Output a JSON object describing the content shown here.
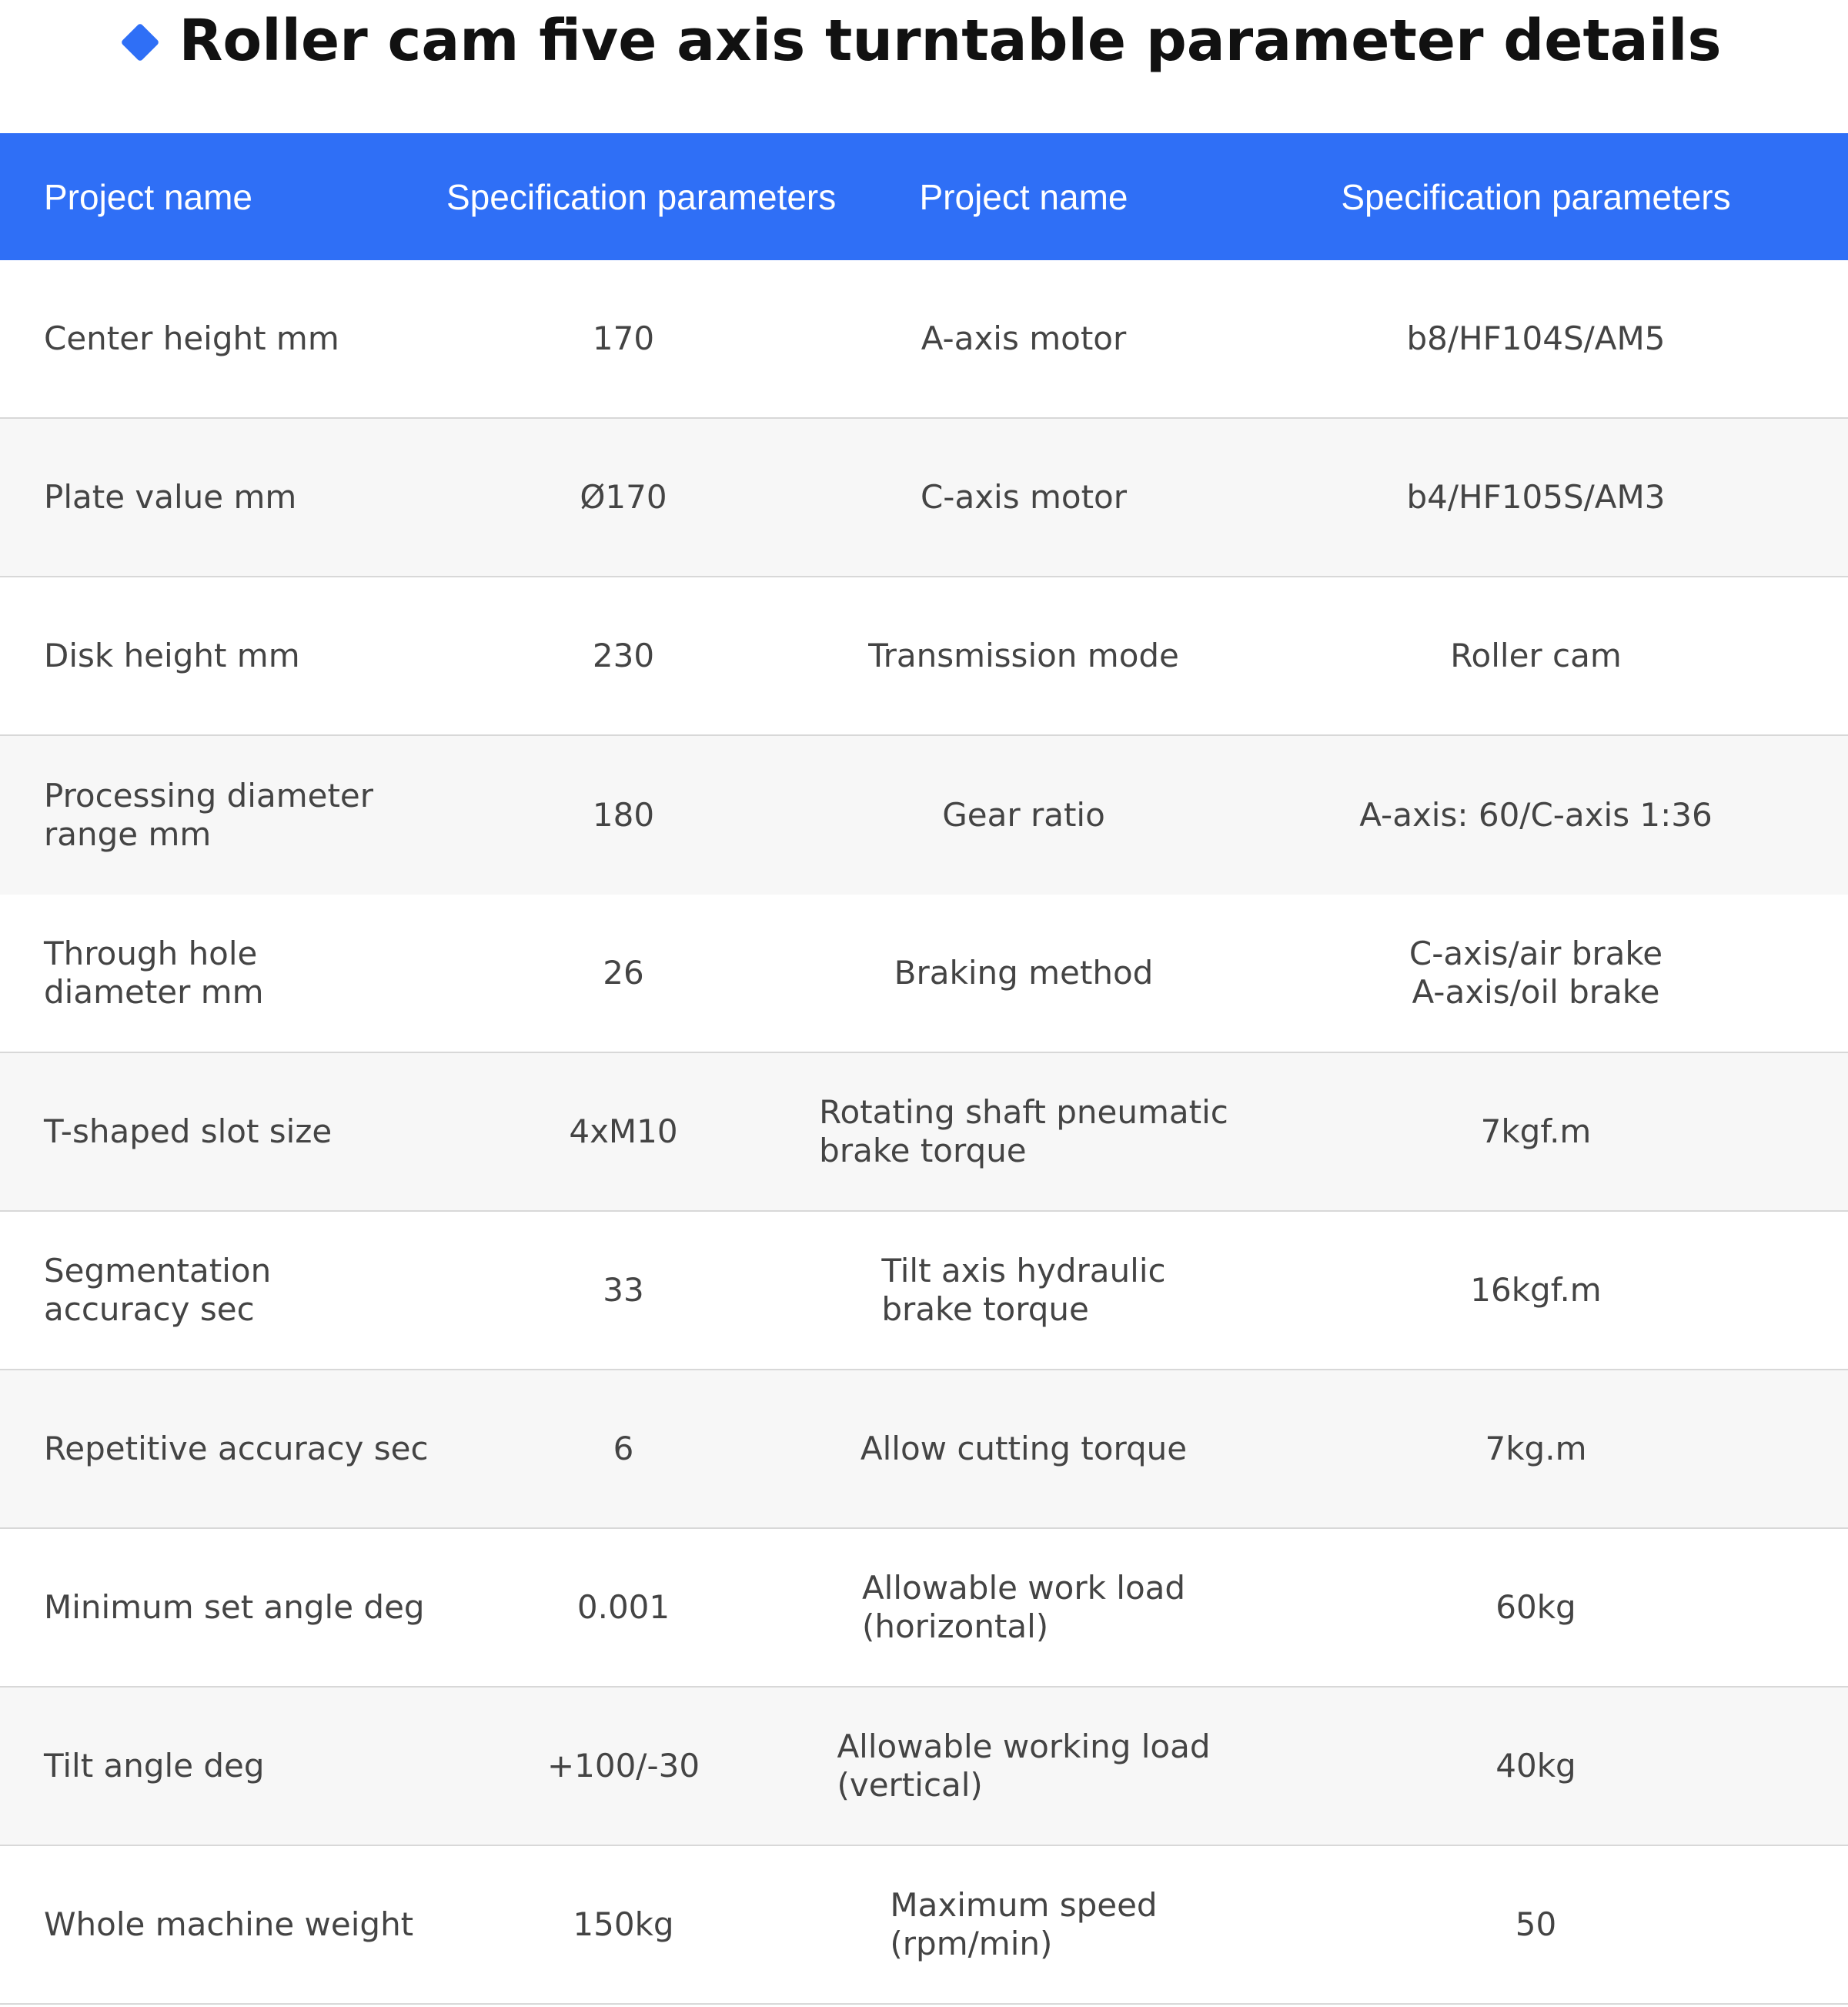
{
  "title": "Roller cam five axis turntable parameter details",
  "colors": {
    "accent": "#2f6ff6",
    "header_text": "#ffffff",
    "body_text": "#444444",
    "alt_row": "#f7f7f7",
    "divider": "#d8d8d8"
  },
  "table": {
    "headers": [
      "Project name",
      "Specification parameters",
      "Project name",
      "Specification parameters"
    ],
    "rows": [
      [
        "Center height mm",
        "170",
        "A-axis motor",
        "b8/HF104S/AM5"
      ],
      [
        "Plate value mm",
        "Ø170",
        "C-axis motor",
        "b4/HF105S/AM3"
      ],
      [
        "Disk height mm",
        "230",
        "Transmission mode",
        "Roller cam"
      ],
      [
        "Processing diameter\nrange mm",
        "180",
        "Gear ratio",
        "A-axis: 60/C-axis 1:36"
      ],
      [
        "Through hole\ndiameter mm",
        "26",
        "Braking method",
        "C-axis/air brake\nA-axis/oil brake"
      ],
      [
        "T-shaped slot size",
        "4xM10",
        "Rotating shaft pneumatic\nbrake torque",
        "7kgf.m"
      ],
      [
        "Segmentation\naccuracy sec",
        "33",
        "Tilt axis hydraulic\nbrake torque",
        "16kgf.m"
      ],
      [
        "Repetitive accuracy sec",
        "6",
        "Allow cutting torque",
        "7kg.m"
      ],
      [
        "Minimum set angle deg",
        "0.001",
        "Allowable work load\n(horizontal)",
        "60kg"
      ],
      [
        "Tilt angle deg",
        "+100/-30",
        "Allowable working load\n(vertical)",
        "40kg"
      ],
      [
        "Whole machine weight",
        "150kg",
        "Maximum speed\n(rpm/min)",
        "50"
      ]
    ]
  }
}
